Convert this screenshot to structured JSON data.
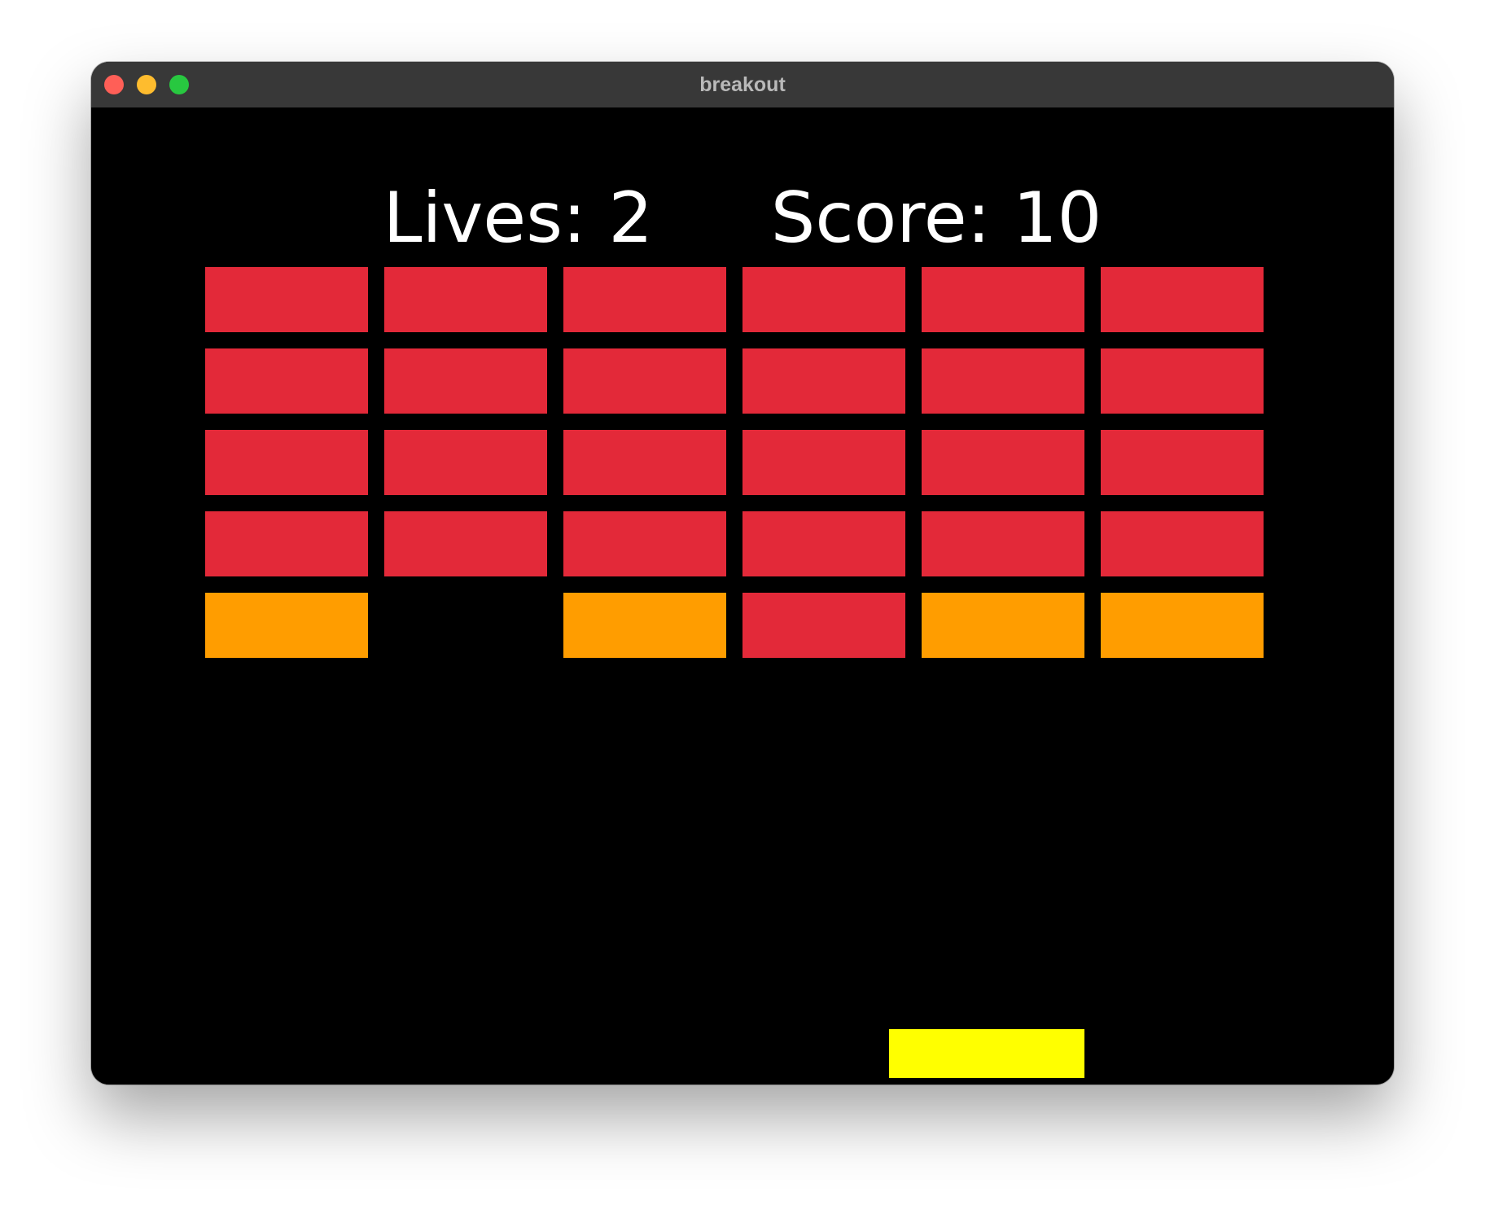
{
  "window": {
    "title": "breakout"
  },
  "hud": {
    "lives_label": "Lives:",
    "lives": "2",
    "score_label": "Score:",
    "score": "10"
  },
  "colors": {
    "red_brick": "#e32939",
    "orange_brick": "#ff9d00",
    "paddle": "#ffff00",
    "ball": "#ffffff",
    "background": "#000000"
  },
  "bricks": [
    [
      "red",
      "red",
      "red",
      "red",
      "red",
      "red"
    ],
    [
      "red",
      "red",
      "red",
      "red",
      "red",
      "red"
    ],
    [
      "red",
      "red",
      "red",
      "red",
      "red",
      "red"
    ],
    [
      "red",
      "red",
      "red",
      "red",
      "red",
      "red"
    ],
    [
      "orange",
      "none",
      "orange",
      "red",
      "orange",
      "orange"
    ]
  ]
}
